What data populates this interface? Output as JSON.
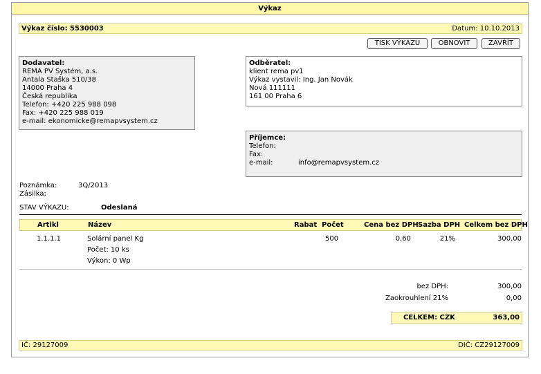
{
  "header": {
    "title": "Výkaz"
  },
  "topbar": {
    "number_label": "Výkaz číslo: 5530003",
    "date": "Datum: 10.10.2013"
  },
  "toolbar": {
    "print_label": "TISK VÝKAZU",
    "refresh_label": "OBNOVIT",
    "close_label": "ZAVŘÍT"
  },
  "supplier": {
    "heading": "Dodavatel:",
    "lines": [
      "REMA PV Systém, a.s.",
      "Antala Staška 510/38",
      "14000 Praha 4",
      "Česká republika",
      "Telefon: +420 225 988 098",
      "Fax: +420 225 988 019",
      "e-mail: ekonomicke@remapvsystem.cz"
    ]
  },
  "customer": {
    "heading": "Odběratel:",
    "lines": [
      "klient rema pv1",
      "Výkaz vystavil: Ing. Jan Novák",
      "Nová 111111",
      "161 00 Praha 6"
    ]
  },
  "recipient": {
    "heading": "Příjemce:",
    "phone_label": "Telefon:",
    "phone": "",
    "fax_label": "Fax:",
    "fax": "",
    "email_label": "e-mail:",
    "email": "info@remapvsystem.cz"
  },
  "notes": {
    "note_label": "Poznámka:",
    "note_value": "3Q/2013",
    "shipment_label": "Zásilka:",
    "shipment_value": ""
  },
  "status": {
    "label": "STAV VÝKAZU:",
    "value": "Odeslaná"
  },
  "table": {
    "headers": {
      "article": "Artikl",
      "name": "Název",
      "discount": "Rabat",
      "count": "Počet",
      "price": "Cena bez DPH",
      "vat_rate": "Sazba DPH",
      "total": "Celkem bez DPH"
    },
    "rows": [
      {
        "article": "1.1.1.1",
        "name": "Solární panel Kg",
        "detail1": "Počet: 10 ks",
        "detail2": "Výkon: 0 Wp",
        "discount": "",
        "count": "500",
        "price": "0,60",
        "vat_rate": "21%",
        "total": "300,00"
      }
    ]
  },
  "summary": {
    "net_label": "bez DPH:",
    "net_value": "300,00",
    "rounding_label": "Zaokrouhlení 21%",
    "rounding_value": "0,00",
    "total_label": "CELKEM: CZK",
    "total_value": "363,00"
  },
  "footer": {
    "ico": "IČ: 29127009",
    "dic": "DIČ: CZ29127009"
  }
}
